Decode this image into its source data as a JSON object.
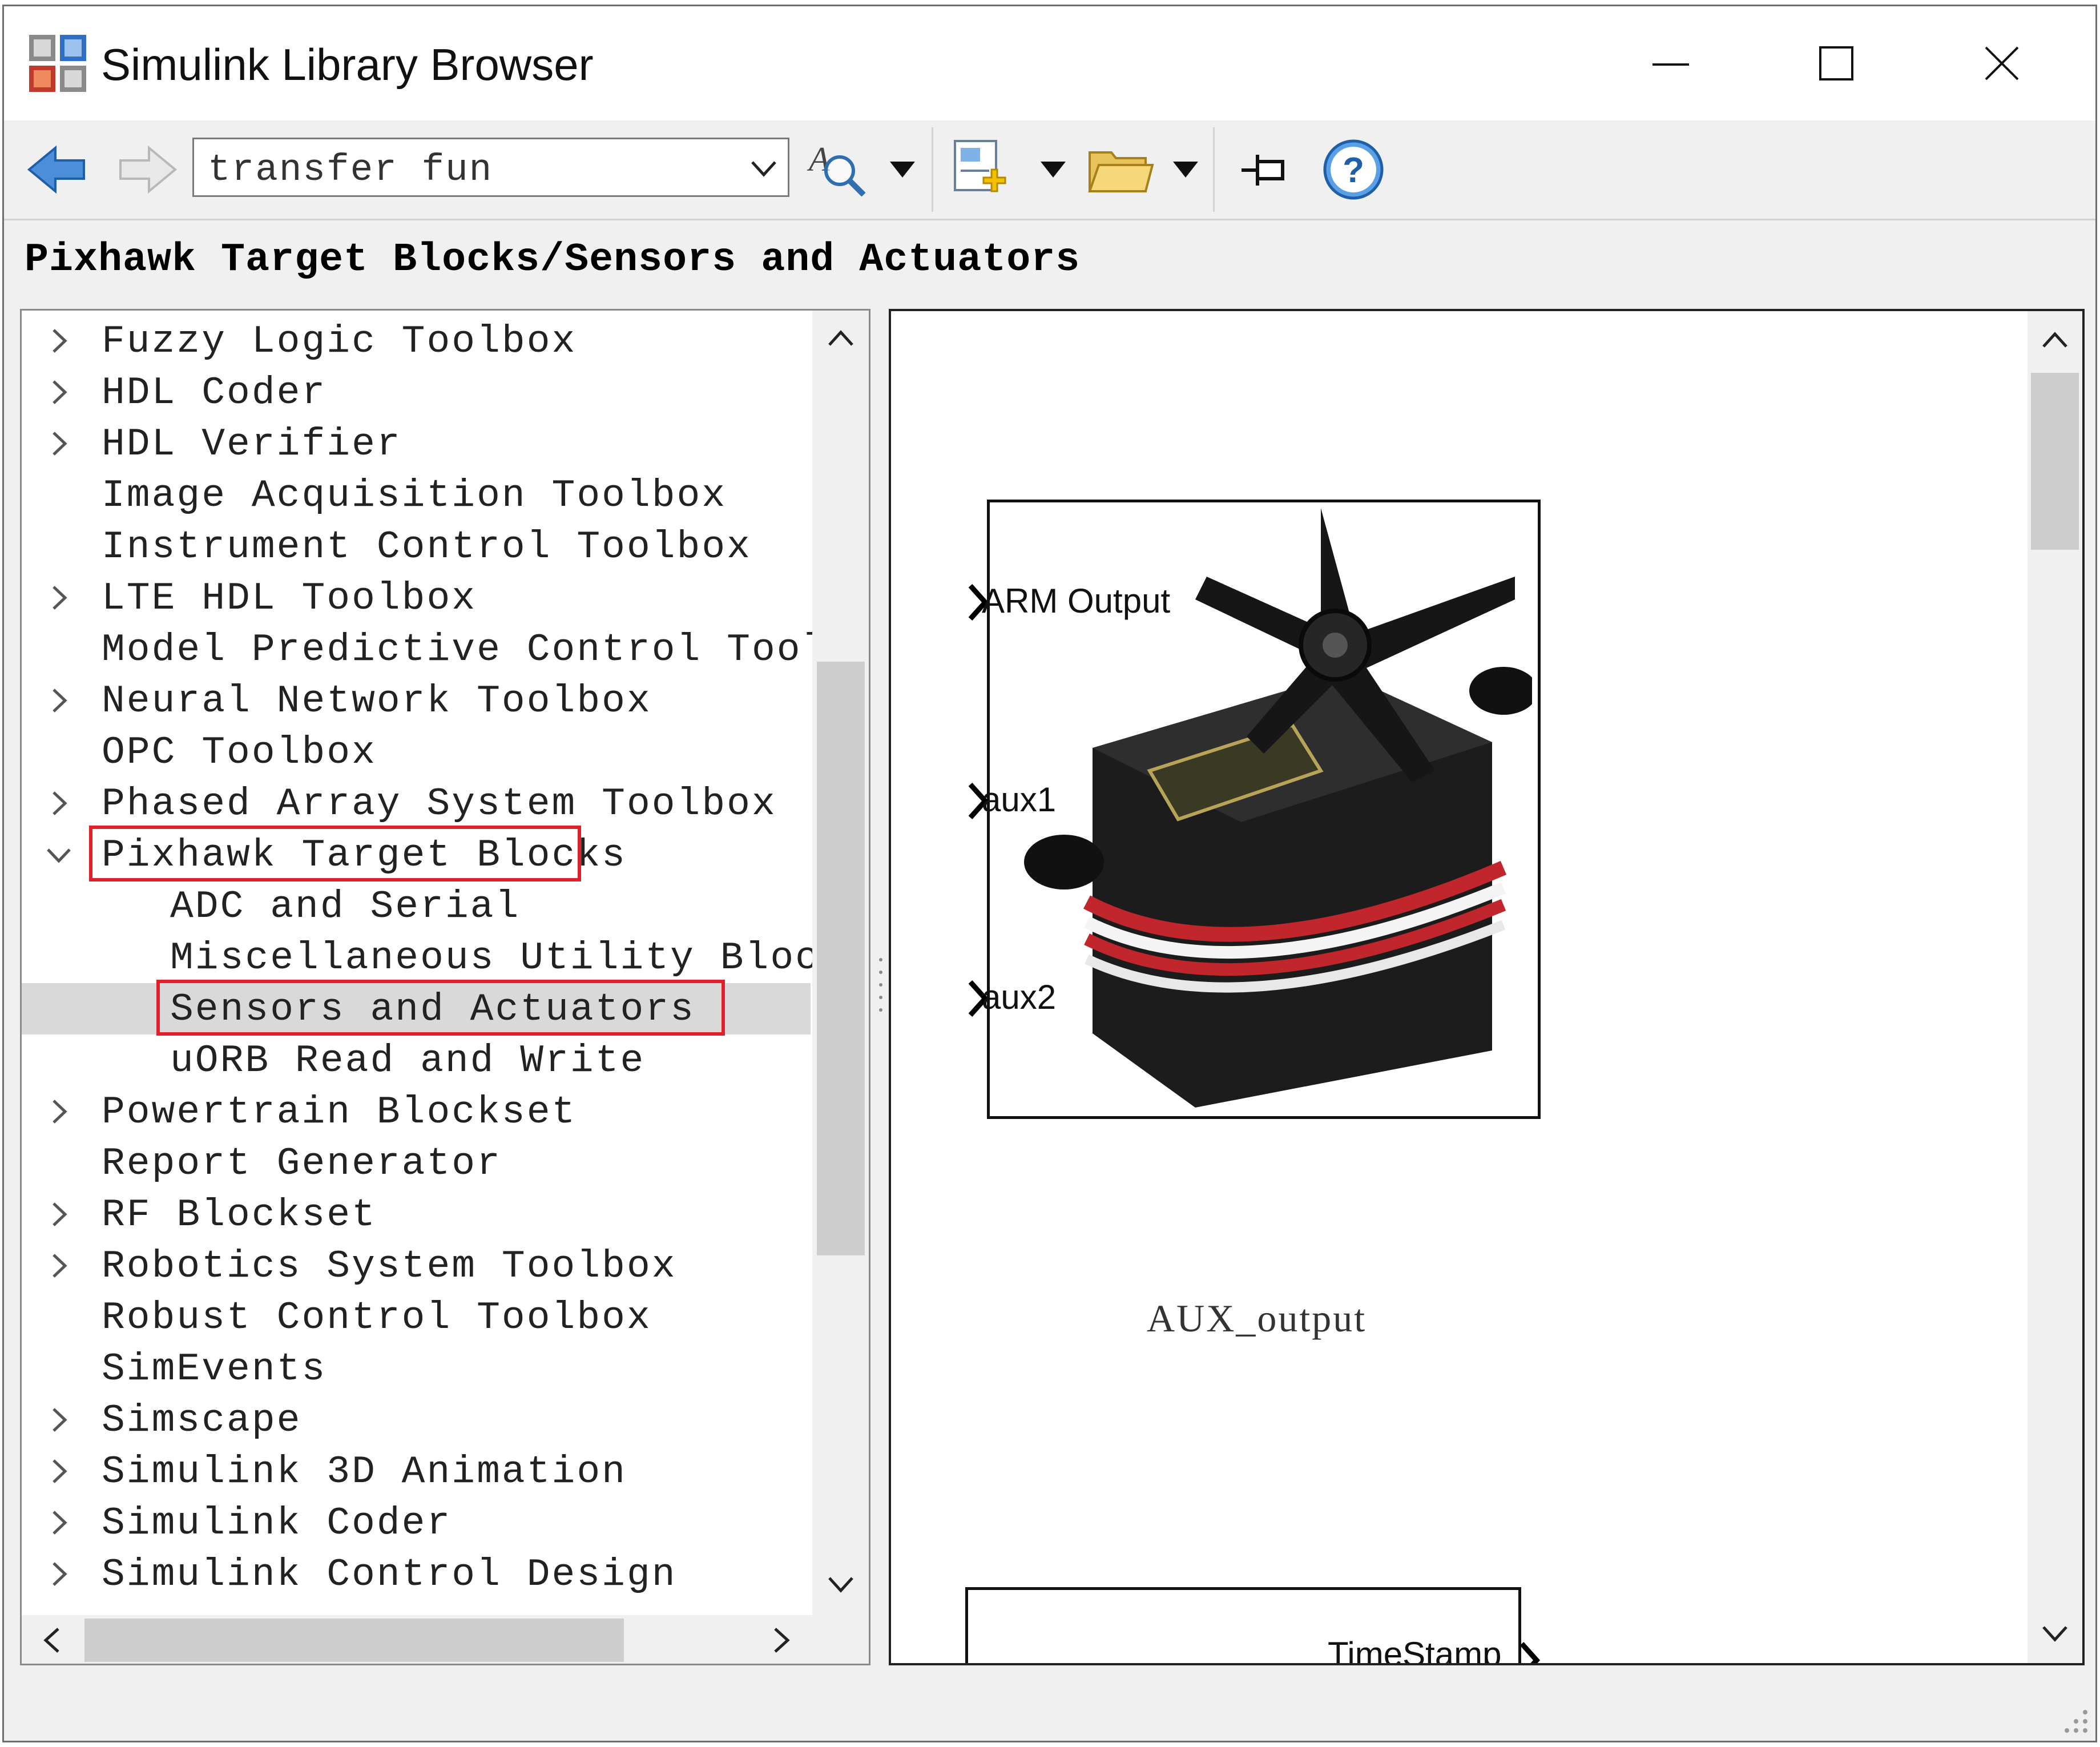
{
  "window": {
    "title": "Simulink Library Browser"
  },
  "toolbar": {
    "search_value": "transfer fun"
  },
  "breadcrumb": "Pixhawk Target Blocks/Sensors and Actuators",
  "tree": {
    "items": [
      {
        "label": "Fuzzy Logic Toolbox",
        "level": 0,
        "state": "collapsed"
      },
      {
        "label": "HDL Coder",
        "level": 0,
        "state": "collapsed"
      },
      {
        "label": "HDL Verifier",
        "level": 0,
        "state": "collapsed"
      },
      {
        "label": "Image Acquisition Toolbox",
        "level": 0,
        "state": "leaf"
      },
      {
        "label": "Instrument Control Toolbox",
        "level": 0,
        "state": "leaf"
      },
      {
        "label": "LTE HDL Toolbox",
        "level": 0,
        "state": "collapsed"
      },
      {
        "label": "Model Predictive Control Toolbox",
        "level": 0,
        "state": "leaf"
      },
      {
        "label": "Neural Network Toolbox",
        "level": 0,
        "state": "collapsed"
      },
      {
        "label": "OPC Toolbox",
        "level": 0,
        "state": "leaf"
      },
      {
        "label": "Phased Array System Toolbox",
        "level": 0,
        "state": "collapsed"
      },
      {
        "label": "Pixhawk Target Blocks",
        "level": 0,
        "state": "expanded",
        "highlighted": true
      },
      {
        "label": "ADC and Serial",
        "level": 1,
        "state": "leaf"
      },
      {
        "label": "Miscellaneous Utility Blocks",
        "level": 1,
        "state": "leaf"
      },
      {
        "label": "Sensors and Actuators",
        "level": 1,
        "state": "leaf",
        "selected": true,
        "highlighted": true
      },
      {
        "label": "uORB Read and Write",
        "level": 1,
        "state": "leaf"
      },
      {
        "label": "Powertrain Blockset",
        "level": 0,
        "state": "collapsed"
      },
      {
        "label": "Report Generator",
        "level": 0,
        "state": "leaf"
      },
      {
        "label": "RF Blockset",
        "level": 0,
        "state": "collapsed"
      },
      {
        "label": "Robotics System Toolbox",
        "level": 0,
        "state": "collapsed"
      },
      {
        "label": "Robust Control Toolbox",
        "level": 0,
        "state": "leaf"
      },
      {
        "label": "SimEvents",
        "level": 0,
        "state": "leaf"
      },
      {
        "label": "Simscape",
        "level": 0,
        "state": "collapsed"
      },
      {
        "label": "Simulink 3D Animation",
        "level": 0,
        "state": "collapsed"
      },
      {
        "label": "Simulink Coder",
        "level": 0,
        "state": "collapsed"
      },
      {
        "label": "Simulink Control Design",
        "level": 0,
        "state": "collapsed"
      }
    ]
  },
  "preview": {
    "block": {
      "name": "AUX_output",
      "ports": [
        "ARM Output",
        "aux1",
        "aux2"
      ]
    },
    "block2": {
      "port": "TimeStamp"
    }
  },
  "colors": {
    "highlight_box": "#e0202a",
    "selection": "#d9d9d9"
  }
}
